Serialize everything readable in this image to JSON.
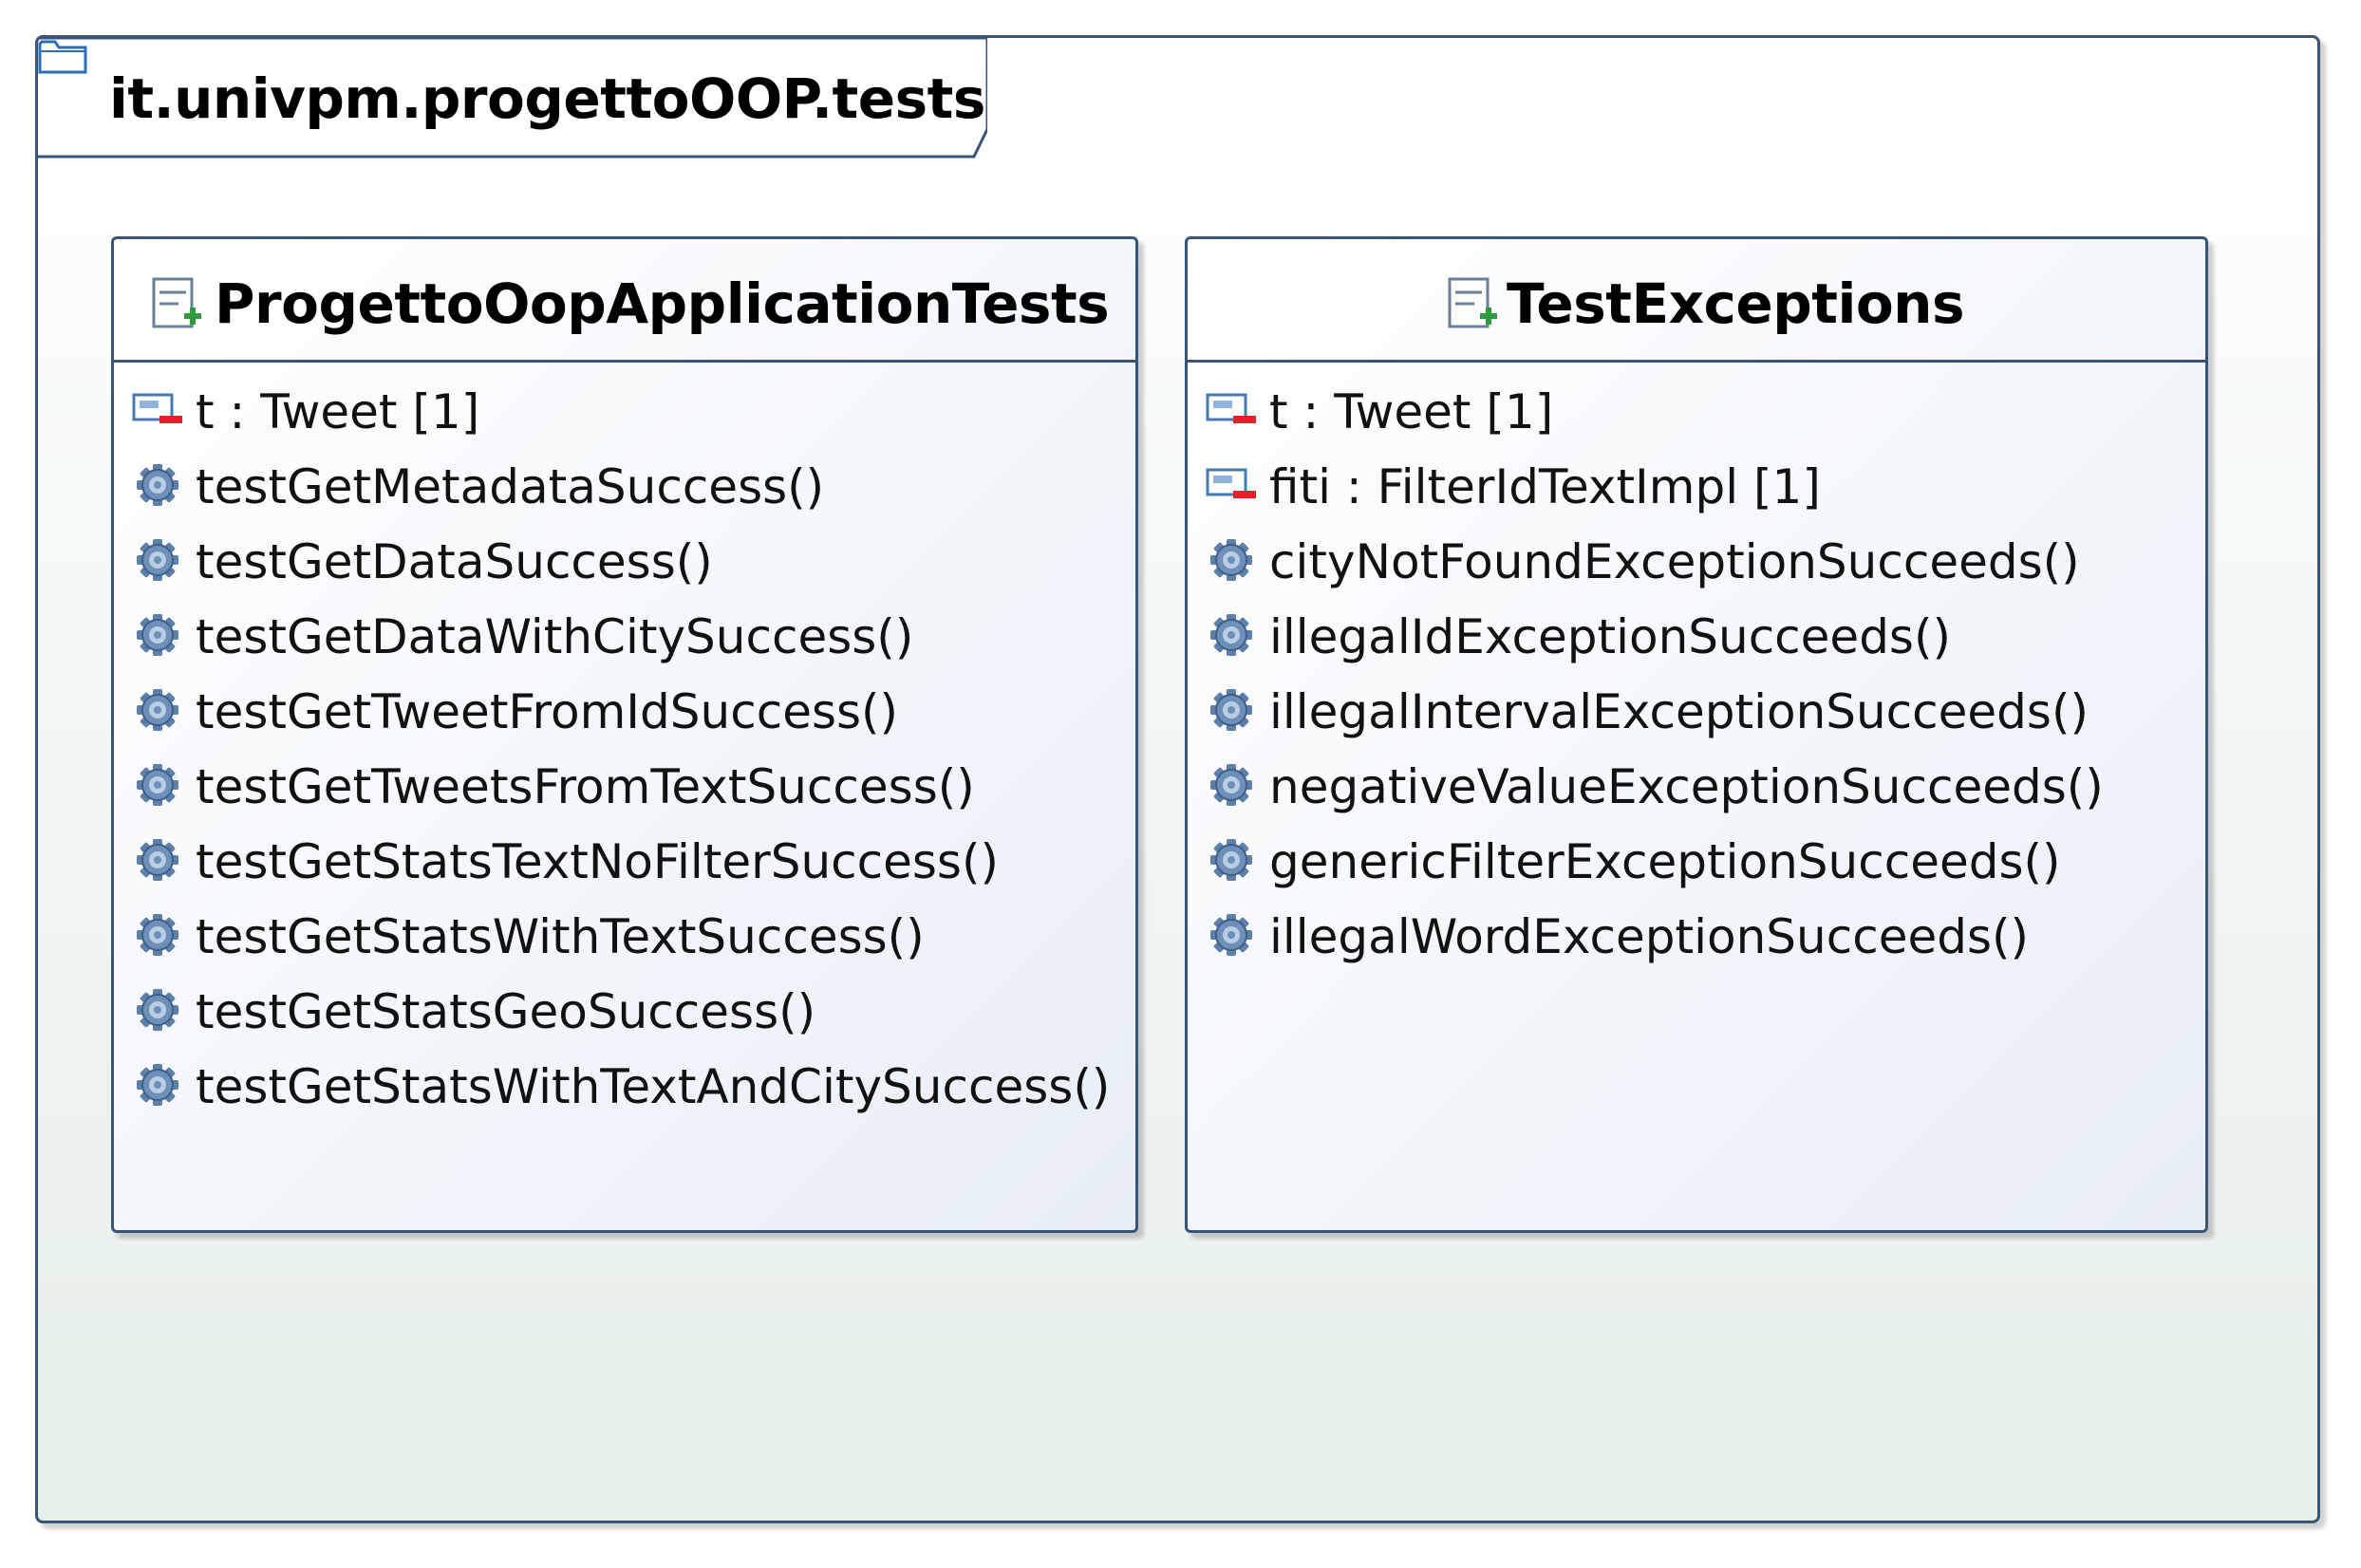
{
  "package": {
    "icon": "folder-icon",
    "name": "it.univpm.progettoOOP.tests"
  },
  "classes": [
    {
      "name": "ProgettoOopApplicationTests",
      "icon": "test-class-icon",
      "members": [
        {
          "kind": "attribute",
          "icon": "private-attribute-icon",
          "text": "t : Tweet [1]"
        },
        {
          "kind": "operation",
          "icon": "gear-icon",
          "text": "testGetMetadataSuccess()"
        },
        {
          "kind": "operation",
          "icon": "gear-icon",
          "text": "testGetDataSuccess()"
        },
        {
          "kind": "operation",
          "icon": "gear-icon",
          "text": "testGetDataWithCitySuccess()"
        },
        {
          "kind": "operation",
          "icon": "gear-icon",
          "text": "testGetTweetFromIdSuccess()"
        },
        {
          "kind": "operation",
          "icon": "gear-icon",
          "text": "testGetTweetsFromTextSuccess()"
        },
        {
          "kind": "operation",
          "icon": "gear-icon",
          "text": "testGetStatsTextNoFilterSuccess()"
        },
        {
          "kind": "operation",
          "icon": "gear-icon",
          "text": "testGetStatsWithTextSuccess()"
        },
        {
          "kind": "operation",
          "icon": "gear-icon",
          "text": "testGetStatsGeoSuccess()"
        },
        {
          "kind": "operation",
          "icon": "gear-icon",
          "text": "testGetStatsWithTextAndCitySuccess()"
        }
      ]
    },
    {
      "name": "TestExceptions",
      "icon": "test-class-icon",
      "members": [
        {
          "kind": "attribute",
          "icon": "private-attribute-icon",
          "text": "t : Tweet [1]"
        },
        {
          "kind": "attribute",
          "icon": "private-attribute-icon",
          "text": "fiti : FilterIdTextImpl [1]"
        },
        {
          "kind": "operation",
          "icon": "gear-icon",
          "text": "cityNotFoundExceptionSucceeds()"
        },
        {
          "kind": "operation",
          "icon": "gear-icon",
          "text": "illegalIdExceptionSucceeds()"
        },
        {
          "kind": "operation",
          "icon": "gear-icon",
          "text": "illegalIntervalExceptionSucceeds()"
        },
        {
          "kind": "operation",
          "icon": "gear-icon",
          "text": "negativeValueExceptionSucceeds()"
        },
        {
          "kind": "operation",
          "icon": "gear-icon",
          "text": "genericFilterExceptionSucceeds()"
        },
        {
          "kind": "operation",
          "icon": "gear-icon",
          "text": "illegalWordExceptionSucceeds()"
        }
      ]
    }
  ]
}
